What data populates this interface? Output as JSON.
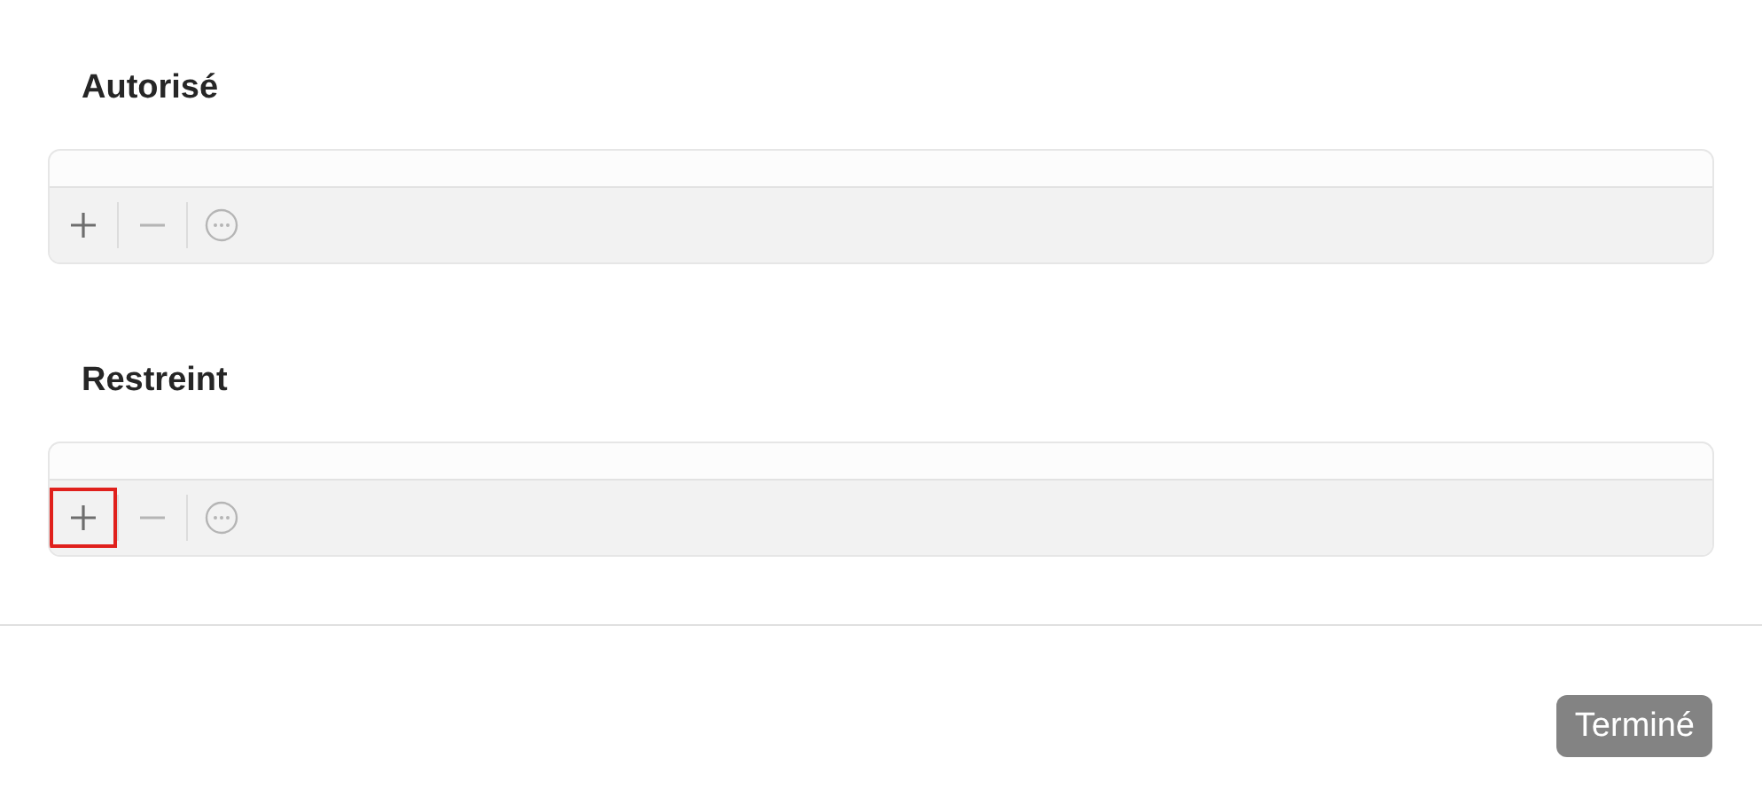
{
  "sections": [
    {
      "title": "Autorisé",
      "toolbar": [
        {
          "kind": "add",
          "disabled": false,
          "highlighted": false
        },
        {
          "kind": "remove",
          "disabled": true,
          "highlighted": false
        },
        {
          "kind": "more",
          "disabled": true,
          "highlighted": false
        }
      ]
    },
    {
      "title": "Restreint",
      "toolbar": [
        {
          "kind": "add",
          "disabled": false,
          "highlighted": true
        },
        {
          "kind": "remove",
          "disabled": true,
          "highlighted": false
        },
        {
          "kind": "more",
          "disabled": true,
          "highlighted": false
        }
      ]
    }
  ],
  "done_button": {
    "label": "Terminé"
  }
}
